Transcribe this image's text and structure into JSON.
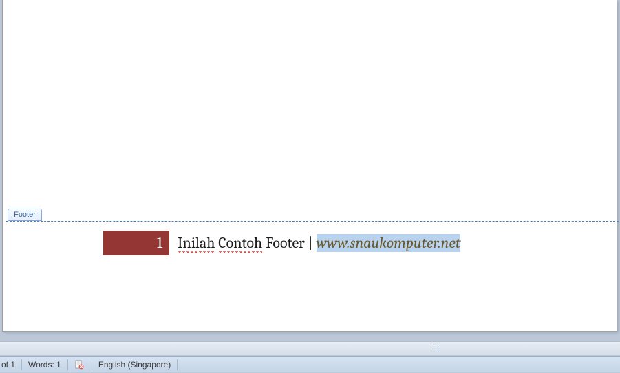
{
  "footer_section": {
    "tab_label": "Footer",
    "page_number": "1",
    "text_part1": "Inilah",
    "text_part2": "Contoh",
    "text_part3": "Footer |",
    "link_selected": "www.snaukomputer.net"
  },
  "status_bar": {
    "page_indicator": "of 1",
    "word_count": "Words: 1",
    "language": "English (Singapore)"
  }
}
